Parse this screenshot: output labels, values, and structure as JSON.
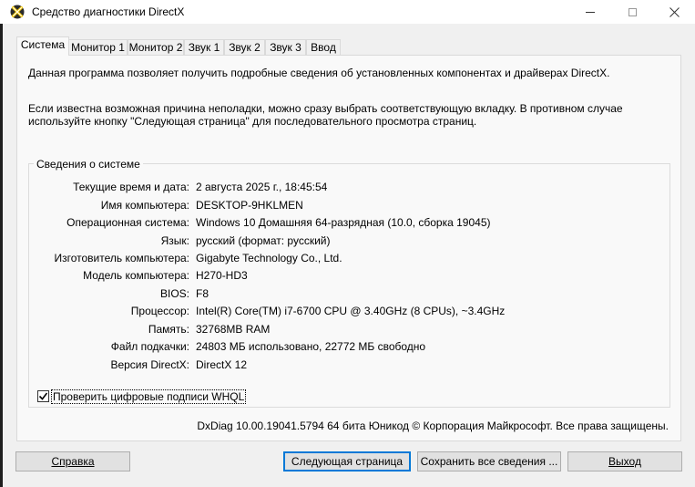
{
  "window": {
    "title": "Средство диагностики DirectX",
    "icon": "directx-x-icon"
  },
  "tabs": [
    {
      "label": "Система",
      "active": true
    },
    {
      "label": "Монитор 1",
      "active": false
    },
    {
      "label": "Монитор 2",
      "active": false
    },
    {
      "label": "Звук 1",
      "active": false
    },
    {
      "label": "Звук 2",
      "active": false
    },
    {
      "label": "Звук 3",
      "active": false
    },
    {
      "label": "Ввод",
      "active": false
    }
  ],
  "intro": {
    "line1": "Данная программа позволяет получить подробные сведения об установленных компонентах и драйверах DirectX.",
    "line2": "Если известна возможная причина неполадки, можно сразу выбрать соответствующую вкладку. В противном случае используйте кнопку \"Следующая страница\" для последовательного просмотра страниц."
  },
  "system_info": {
    "group_title": "Сведения о системе",
    "rows": [
      {
        "label": "Текущие время и дата:",
        "value": "2 августа 2025 г., 18:45:54"
      },
      {
        "label": "Имя компьютера:",
        "value": "DESKTOP-9HKLMEN"
      },
      {
        "label": "Операционная система:",
        "value": "Windows 10 Домашняя 64-разрядная (10.0, сборка 19045)"
      },
      {
        "label": "Язык:",
        "value": "русский (формат: русский)"
      },
      {
        "label": "Изготовитель компьютера:",
        "value": "Gigabyte Technology Co., Ltd."
      },
      {
        "label": "Модель компьютера:",
        "value": "H270-HD3"
      },
      {
        "label": "BIOS:",
        "value": "F8"
      },
      {
        "label": "Процессор:",
        "value": "Intel(R) Core(TM) i7-6700 CPU @ 3.40GHz (8 CPUs), ~3.4GHz"
      },
      {
        "label": "Память:",
        "value": "32768MB RAM"
      },
      {
        "label": "Файл подкачки:",
        "value": "24803 МБ использовано, 22772 МБ свободно"
      },
      {
        "label": "Версия DirectX:",
        "value": "DirectX 12"
      }
    ]
  },
  "whql_checkbox": {
    "label": "Проверить цифровые подписи WHQL",
    "checked": true
  },
  "footer_note": "DxDiag 10.00.19041.5794 64 бита Юникод © Корпорация Майкрософт. Все права защищены.",
  "buttons": {
    "help": "Справка",
    "next_page": "Следующая страница",
    "save_all": "Сохранить все сведения ...",
    "exit": "Выход"
  },
  "colors": {
    "window_bg": "#f0f0f0",
    "panel_bg": "#f9f9f9",
    "default_button_border": "#0078d7"
  }
}
